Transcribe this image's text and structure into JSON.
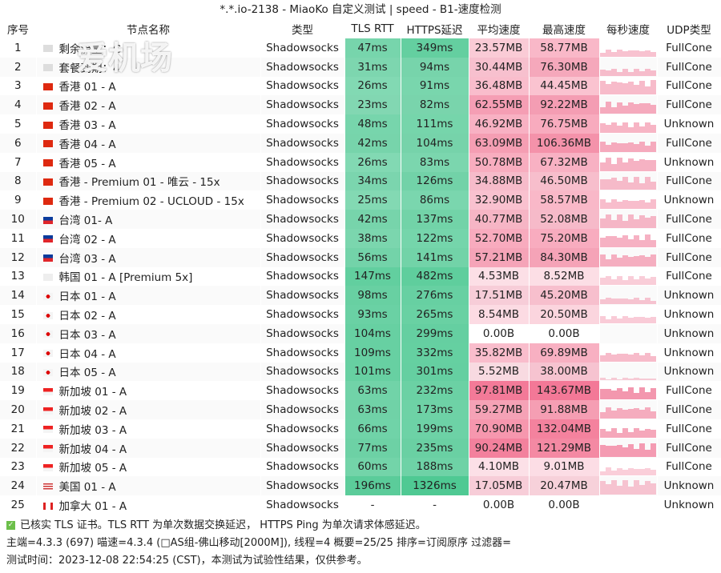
{
  "title": "*.*.io-2138 - MiaoKo 自定义测试 | speed - B1-速度检测",
  "watermark": "爱机场",
  "headers": [
    "序号",
    "节点名称",
    "类型",
    "TLS RTT",
    "HTTPS延迟",
    "平均速度",
    "最高速度",
    "每秒速度",
    "UDP类型"
  ],
  "colors": {
    "green": "#2fbf80",
    "pink": "#f0567c"
  },
  "rows": [
    {
      "no": "1",
      "flag": "other",
      "name": "剩余流量：G",
      "type": "Shadowsocks",
      "tls": "47ms",
      "https": "349ms",
      "avg": "23.57MB",
      "max": "58.77MB",
      "udp": "FullCone"
    },
    {
      "no": "2",
      "flag": "other",
      "name": "套餐到期：4-",
      "type": "Shadowsocks",
      "tls": "31ms",
      "https": "94ms",
      "avg": "30.44MB",
      "max": "76.30MB",
      "udp": "FullCone"
    },
    {
      "no": "3",
      "flag": "hk",
      "name": "香港 01 - A",
      "type": "Shadowsocks",
      "tls": "26ms",
      "https": "91ms",
      "avg": "36.48MB",
      "max": "44.45MB",
      "udp": "FullCone"
    },
    {
      "no": "4",
      "flag": "hk",
      "name": "香港 02 - A",
      "type": "Shadowsocks",
      "tls": "23ms",
      "https": "82ms",
      "avg": "62.55MB",
      "max": "92.22MB",
      "udp": "FullCone"
    },
    {
      "no": "5",
      "flag": "hk",
      "name": "香港 03 - A",
      "type": "Shadowsocks",
      "tls": "48ms",
      "https": "111ms",
      "avg": "46.92MB",
      "max": "76.75MB",
      "udp": "Unknown"
    },
    {
      "no": "6",
      "flag": "hk",
      "name": "香港 04 - A",
      "type": "Shadowsocks",
      "tls": "42ms",
      "https": "104ms",
      "avg": "63.09MB",
      "max": "106.36MB",
      "udp": "FullCone"
    },
    {
      "no": "7",
      "flag": "hk",
      "name": "香港 05 - A",
      "type": "Shadowsocks",
      "tls": "26ms",
      "https": "83ms",
      "avg": "50.78MB",
      "max": "67.32MB",
      "udp": "Unknown"
    },
    {
      "no": "8",
      "flag": "hk",
      "name": "香港 - Premium 01 - 唯云 - 15x",
      "type": "Shadowsocks",
      "tls": "34ms",
      "https": "126ms",
      "avg": "34.88MB",
      "max": "46.50MB",
      "udp": "FullCone"
    },
    {
      "no": "9",
      "flag": "hk",
      "name": "香港 - Premium 02 - UCLOUD - 15x",
      "type": "Shadowsocks",
      "tls": "25ms",
      "https": "86ms",
      "avg": "32.90MB",
      "max": "58.57MB",
      "udp": "Unknown"
    },
    {
      "no": "10",
      "flag": "tw",
      "name": "台湾 01- A",
      "type": "Shadowsocks",
      "tls": "42ms",
      "https": "137ms",
      "avg": "40.77MB",
      "max": "52.08MB",
      "udp": "FullCone"
    },
    {
      "no": "11",
      "flag": "tw",
      "name": "台湾 02 - A",
      "type": "Shadowsocks",
      "tls": "38ms",
      "https": "122ms",
      "avg": "52.70MB",
      "max": "75.20MB",
      "udp": "FullCone"
    },
    {
      "no": "12",
      "flag": "tw",
      "name": "台湾 03 - A",
      "type": "Shadowsocks",
      "tls": "56ms",
      "https": "141ms",
      "avg": "57.21MB",
      "max": "84.30MB",
      "udp": "FullCone"
    },
    {
      "no": "13",
      "flag": "kr",
      "name": "韩国 01 - A [Premium 5x]",
      "type": "Shadowsocks",
      "tls": "147ms",
      "https": "482ms",
      "avg": "4.53MB",
      "max": "8.52MB",
      "udp": "FullCone"
    },
    {
      "no": "14",
      "flag": "jp",
      "name": "日本 01 - A",
      "type": "Shadowsocks",
      "tls": "98ms",
      "https": "276ms",
      "avg": "17.51MB",
      "max": "45.20MB",
      "udp": "Unknown"
    },
    {
      "no": "15",
      "flag": "jp",
      "name": "日本 02 - A",
      "type": "Shadowsocks",
      "tls": "93ms",
      "https": "265ms",
      "avg": "8.54MB",
      "max": "20.50MB",
      "udp": "Unknown"
    },
    {
      "no": "16",
      "flag": "jp",
      "name": "日本 03 - A",
      "type": "Shadowsocks",
      "tls": "104ms",
      "https": "299ms",
      "avg": "0.00B",
      "max": "0.00B",
      "udp": "Unknown"
    },
    {
      "no": "17",
      "flag": "jp",
      "name": "日本 04 - A",
      "type": "Shadowsocks",
      "tls": "109ms",
      "https": "332ms",
      "avg": "35.82MB",
      "max": "69.89MB",
      "udp": "Unknown"
    },
    {
      "no": "18",
      "flag": "jp",
      "name": "日本 05 - A",
      "type": "Shadowsocks",
      "tls": "101ms",
      "https": "301ms",
      "avg": "5.52MB",
      "max": "38.00MB",
      "udp": "Unknown"
    },
    {
      "no": "19",
      "flag": "sg",
      "name": "新加坡 01 - A",
      "type": "Shadowsocks",
      "tls": "63ms",
      "https": "232ms",
      "avg": "97.81MB",
      "max": "143.67MB",
      "udp": "FullCone"
    },
    {
      "no": "20",
      "flag": "sg",
      "name": "新加坡 02 - A",
      "type": "Shadowsocks",
      "tls": "63ms",
      "https": "173ms",
      "avg": "59.27MB",
      "max": "91.88MB",
      "udp": "FullCone"
    },
    {
      "no": "21",
      "flag": "sg",
      "name": "新加坡 03 - A",
      "type": "Shadowsocks",
      "tls": "66ms",
      "https": "199ms",
      "avg": "70.90MB",
      "max": "132.04MB",
      "udp": "FullCone"
    },
    {
      "no": "22",
      "flag": "sg",
      "name": "新加坡 04 - A",
      "type": "Shadowsocks",
      "tls": "77ms",
      "https": "235ms",
      "avg": "90.24MB",
      "max": "121.29MB",
      "udp": "FullCone"
    },
    {
      "no": "23",
      "flag": "sg",
      "name": "新加坡 05 - A",
      "type": "Shadowsocks",
      "tls": "60ms",
      "https": "188ms",
      "avg": "4.10MB",
      "max": "9.01MB",
      "udp": "FullCone"
    },
    {
      "no": "24",
      "flag": "us",
      "name": "美国 01 - A",
      "type": "Shadowsocks",
      "tls": "196ms",
      "https": "1326ms",
      "avg": "17.05MB",
      "max": "20.47MB",
      "udp": "Unknown"
    },
    {
      "no": "25",
      "flag": "ca",
      "name": "加拿大 01 - A",
      "type": "Shadowsocks",
      "tls": "-",
      "https": "-",
      "avg": "0.00B",
      "max": "0.00B",
      "udp": "Unknown"
    }
  ],
  "footer": {
    "line1": "已核实 TLS 证书。TLS RTT 为单次数据交换延迟， HTTPS Ping 为单次请求体感延迟。",
    "line2": "主端=4.3.3 (697) 喵速=4.3.4 (□AS组-佛山移动[2000M]), 线程=4 概要=25/25 排序=订阅原序 过滤器=",
    "line3": "测试时间：2023-12-08 22:54:25 (CST)，本测试为试验性结果，仅供参考。"
  }
}
